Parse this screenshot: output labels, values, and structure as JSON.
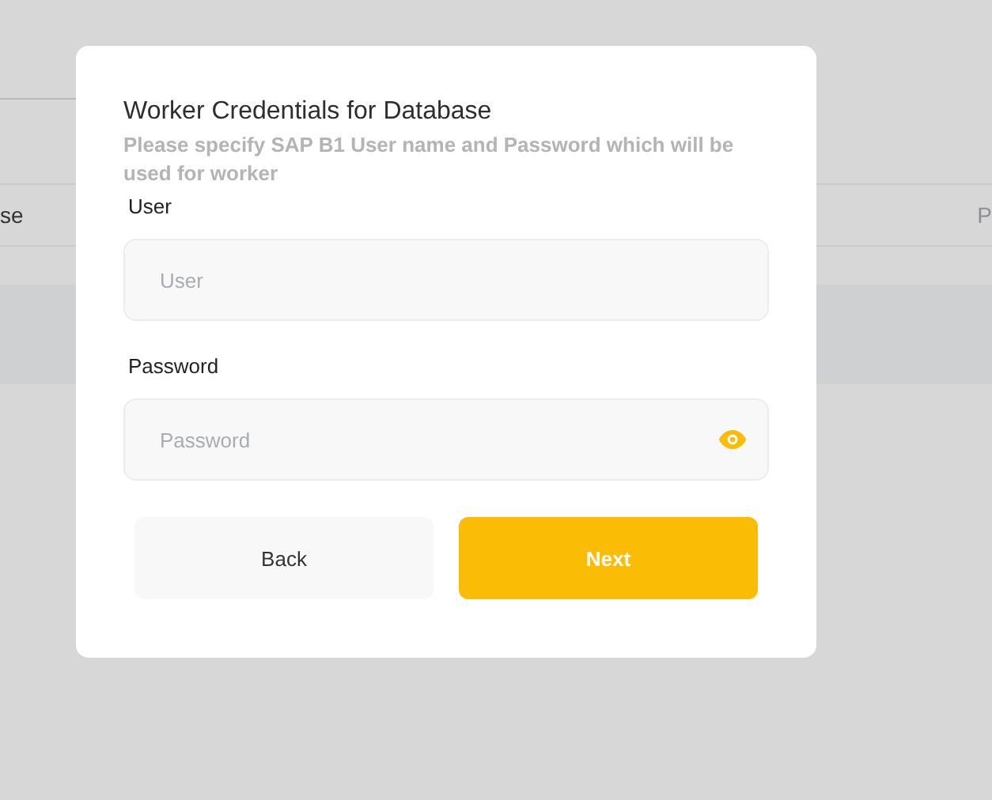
{
  "background": {
    "table_header": {
      "column_1": "se",
      "column_2": "P"
    }
  },
  "dialog": {
    "title": "Worker Credentials for Database",
    "subtitle": "Please specify SAP B1 User name and Password which will be used for worker",
    "fields": [
      {
        "kind": "text",
        "label": "User",
        "placeholder": "User"
      },
      {
        "kind": "password",
        "label": "Password",
        "placeholder": "Password"
      }
    ],
    "buttons": [
      {
        "kind": "secondary",
        "label": "Back"
      },
      {
        "kind": "primary",
        "label": "Next"
      }
    ]
  }
}
